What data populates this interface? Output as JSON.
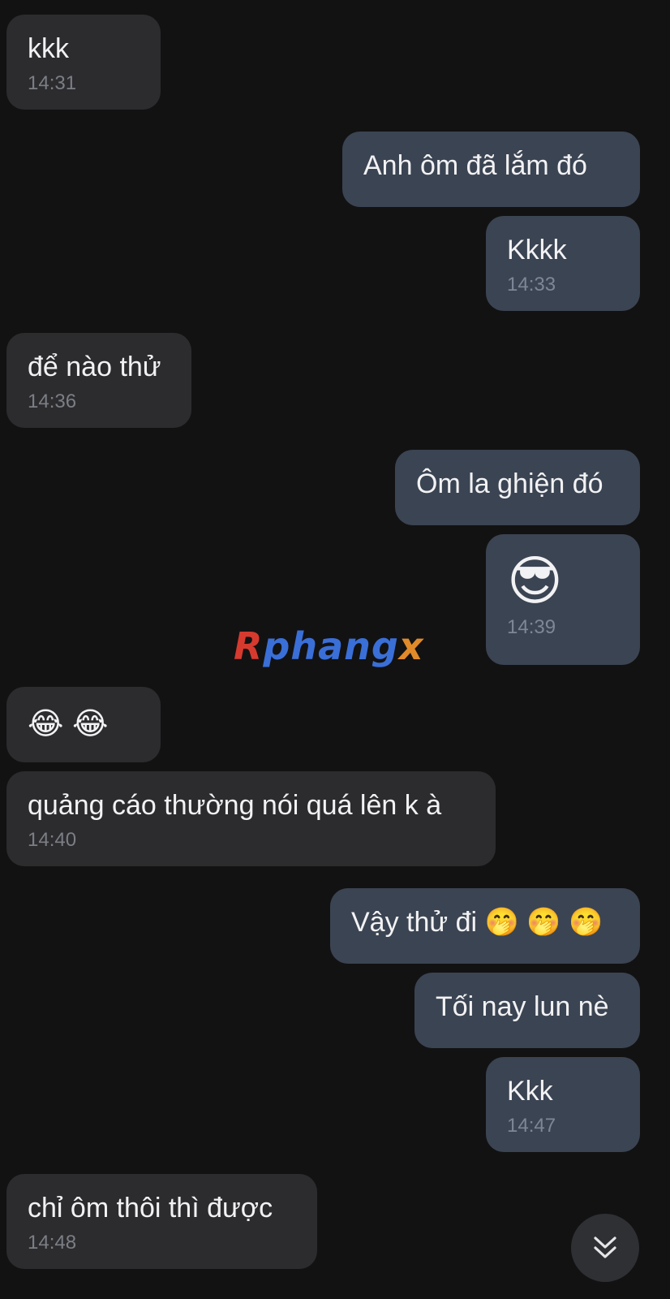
{
  "messages": [
    {
      "direction": "received",
      "text": "kkk",
      "time": "14:31"
    },
    {
      "direction": "sent",
      "text": "Anh ôm đã lắm đó",
      "time": ""
    },
    {
      "direction": "sent",
      "text": "Kkkk",
      "time": "14:33"
    },
    {
      "direction": "received",
      "text": "để nào thử",
      "time": "14:36"
    },
    {
      "direction": "sent",
      "text": "Ôm la ghiện đó",
      "time": ""
    },
    {
      "direction": "sent",
      "text": "😎",
      "time": "14:39"
    },
    {
      "direction": "received",
      "text": "😂 😂",
      "time": ""
    },
    {
      "direction": "received",
      "text": "quảng cáo thường nói quá lên k à",
      "time": "14:40"
    },
    {
      "direction": "sent",
      "text": "Vậy thử đi 🤭 🤭 🤭",
      "time": ""
    },
    {
      "direction": "sent",
      "text": "Tối nay lun nè",
      "time": ""
    },
    {
      "direction": "sent",
      "text": "Kkk",
      "time": "14:47"
    },
    {
      "direction": "received",
      "text": "chỉ ôm thôi thì được",
      "time": "14:48"
    }
  ],
  "watermark": {
    "first": "R",
    "middle": "phang",
    "last": "x"
  },
  "scroll_button": {
    "icon": "double-chevron-down-icon"
  },
  "colors": {
    "background": "#121213",
    "received_bubble": "#2c2c2e",
    "sent_bubble": "#3b4452",
    "time_text": "#7b7e85"
  }
}
